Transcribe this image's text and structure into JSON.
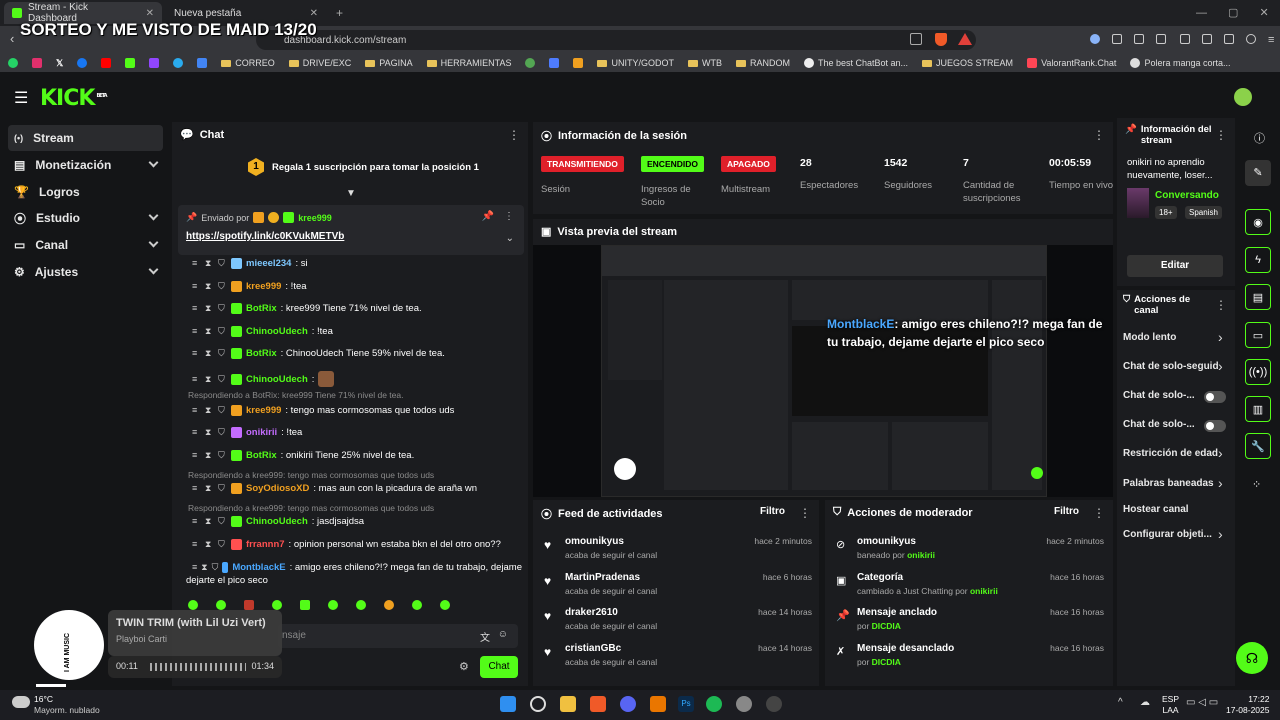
{
  "browser": {
    "tab1": "Stream - Kick Dashboard",
    "tab2": "Nueva pestaña",
    "url": "dashboard.kick.com/stream",
    "overlay_title": "SORTEO Y ME VISTO DE MAID 13/20"
  },
  "bookmarks": [
    "CORREO",
    "DRIVE/EXC",
    "PAGINA",
    "HERRAMIENTAS",
    "UNITY/GODOT",
    "WTB",
    "RANDOM",
    "The best ChatBot an...",
    "JUEGOS STREAM",
    "ValorantRank.Chat",
    "Polera manga corta..."
  ],
  "logo": "KICK",
  "logo_sup": "BETA",
  "nav": [
    "Stream",
    "Monetización",
    "Logros",
    "Estudio",
    "Canal",
    "Ajustes"
  ],
  "chat": {
    "title": "Chat",
    "gift_text": "Regala 1 suscripción para tomar la posición 1",
    "gift_rank": "1",
    "pinned_by": "Enviado por",
    "pinned_user": "kree999",
    "pinned_link": "https://spotify.link/c0KVukMETVb",
    "lines": [
      {
        "user": "mieeel234",
        "color": "#7ec8ff",
        "text": ": si"
      },
      {
        "user": "kree999",
        "color": "#f0a020",
        "text": ": !tea"
      },
      {
        "user": "BotRix",
        "color": "#53fc18",
        "text": ": kree999 Tiene 71% nivel de tea."
      },
      {
        "user": "ChinooUdech",
        "color": "#53fc18",
        "text": ": !tea"
      },
      {
        "user": "BotRix",
        "color": "#53fc18",
        "text": ": ChinooUdech Tiene 59% nivel de tea."
      },
      {
        "user": "ChinooUdech",
        "color": "#53fc18",
        "text": ":"
      },
      {
        "user": "kree999",
        "color": "#f0a020",
        "text": ": tengo mas cormosomas que todos uds"
      },
      {
        "user": "onikirii",
        "color": "#c46cff",
        "text": ": !tea"
      },
      {
        "user": "BotRix",
        "color": "#53fc18",
        "text": ": onikirii Tiene 25% nivel de tea."
      },
      {
        "user": "SoyOdiosoXD",
        "color": "#f0a020",
        "text": ": mas aun con la picadura de araña wn"
      },
      {
        "user": "ChinooUdech",
        "color": "#53fc18",
        "text": ": jasdjsajdsa"
      },
      {
        "user": "frrannn7",
        "color": "#ff5050",
        "text": ": opinion personal wn estaba bkn el del otro ono??"
      },
      {
        "user": "MontblackE",
        "color": "#4aa8ff",
        "text": ": amigo eres chileno?!? mega fan de tu trabajo, dejame"
      },
      {
        "user": "",
        "color": "#fff",
        "text": "dejarte el pico seco"
      }
    ],
    "replies": [
      "Respondiendo a BotRix: kree999 Tiene 71% nivel de tea.",
      "Respondiendo a kree999: tengo mas cormosomas que todos uds",
      "Respondiendo a kree999: tengo mas cormosomas que todos uds"
    ],
    "placeholder": "nsaje",
    "send": "Chat"
  },
  "music": {
    "title": "TWIN TRIM (with Lil Uzi Vert)",
    "artist": "Playboi Carti",
    "elapsed": "00:11",
    "total": "01:34",
    "art_text": "I AM MUSIC"
  },
  "session": {
    "title": "Información de la sesión",
    "items": [
      {
        "pill": "TRANSMITIENDO",
        "pill_bg": "#e0202a",
        "label": "Sesión"
      },
      {
        "pill": "ENCENDIDO",
        "pill_bg": "#53fc18",
        "label": "Ingresos de Socio"
      },
      {
        "pill": "APAGADO",
        "pill_bg": "#e0202a",
        "label": "Multistream"
      },
      {
        "value": "28",
        "label": "Espectadores"
      },
      {
        "value": "1542",
        "label": "Seguidores"
      },
      {
        "value": "7",
        "label": "Cantidad de suscripciones"
      },
      {
        "value": "00:05:59",
        "label": "Tiempo en vivo"
      }
    ]
  },
  "preview": {
    "title": "Vista previa del stream",
    "overlay_user": "MontblackE",
    "overlay_msg": ": amigo eres chileno?!? mega fan de tu trabajo, dejame dejarte el pico seco"
  },
  "stream_info": {
    "title": "Información del stream",
    "stream_title": "onikiri no aprendio nuevamente, loser...",
    "category": "Conversando",
    "tag1": "18+",
    "tag2": "Spanish",
    "edit": "Editar"
  },
  "channel_actions": {
    "title": "Acciones de canal",
    "items": [
      "Modo lento",
      "Chat de solo-seguid",
      "Chat de solo-...",
      "Chat de solo-...",
      "Restricción de edad",
      "Palabras baneadas",
      "Hostear canal",
      "Configurar objeti..."
    ]
  },
  "feed": {
    "title": "Feed de actividades",
    "filter": "Filtro",
    "rows": [
      {
        "name": "omounikyus",
        "sub": "acaba de seguir el canal",
        "time": "hace 2 minutos"
      },
      {
        "name": "MartinPradenas",
        "sub": "acaba de seguir el canal",
        "time": "hace 6 horas"
      },
      {
        "name": "draker2610",
        "sub": "acaba de seguir el canal",
        "time": "hace 14 horas"
      },
      {
        "name": "cristianGBc",
        "sub": "acaba de seguir el canal",
        "time": "hace 14 horas"
      }
    ]
  },
  "mod": {
    "title": "Acciones de moderador",
    "filter": "Filtro",
    "rows": [
      {
        "name": "omounikyus",
        "sub_a": "baneado por ",
        "sub_b": "onikirii",
        "time": "hace 2 minutos"
      },
      {
        "name": "Categoría",
        "sub_a": "cambiado a Just Chatting por ",
        "sub_b": "onikirii",
        "time": "hace 16 horas"
      },
      {
        "name": "Mensaje anclado",
        "sub_a": "por ",
        "sub_b": "DICDIA",
        "time": "hace 16 horas"
      },
      {
        "name": "Mensaje desanclado",
        "sub_a": "por ",
        "sub_b": "DICDIA",
        "time": "hace 16 horas"
      }
    ]
  },
  "taskbar": {
    "temp": "16°C",
    "weather": "Mayorm. nublado",
    "lang1": "ESP",
    "lang2": "LAA",
    "time": "17:22",
    "date": "17-08-2025"
  }
}
